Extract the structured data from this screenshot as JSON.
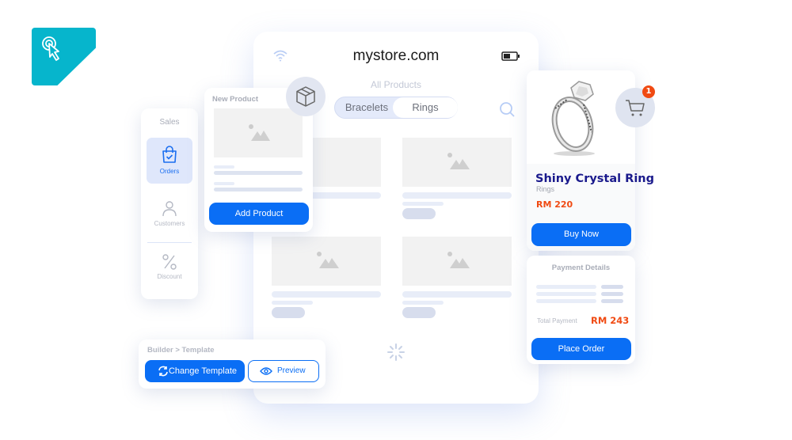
{
  "logo": {
    "icon": "click-cursor-icon",
    "color": "#06b5cc"
  },
  "store": {
    "domain": "mystore.com",
    "section_title": "All Products",
    "categories": [
      "Bracelets",
      "Rings"
    ],
    "active_category": "Rings",
    "icons": {
      "wifi": "wifi-icon",
      "battery": "battery-icon",
      "search": "search-icon",
      "loading": "loading-spinner-icon"
    }
  },
  "sales_menu": {
    "title": "Sales",
    "items": [
      {
        "label": "Orders",
        "icon": "shopping-bag-check-icon",
        "active": true
      },
      {
        "label": "Customers",
        "icon": "user-icon",
        "active": false
      },
      {
        "label": "Discount",
        "icon": "percent-icon",
        "active": false
      }
    ]
  },
  "new_product": {
    "title": "New Product",
    "button": "Add Product",
    "icon": "box-icon"
  },
  "product": {
    "name": "Shiny Crystal Ring",
    "category": "Rings",
    "price": "RM 220",
    "button": "Buy Now",
    "cart_count": "1"
  },
  "payment": {
    "title": "Payment Details",
    "total_label": "Total Payment",
    "total_value": "RM 243",
    "button": "Place Order"
  },
  "builder": {
    "breadcrumb": "Builder > Template",
    "change_button": "Change Template",
    "preview_button": "Preview"
  },
  "colors": {
    "primary": "#0a6ef5",
    "price": "#f04a12",
    "product_name": "#1a1a8c",
    "accent": "#06b5cc"
  }
}
